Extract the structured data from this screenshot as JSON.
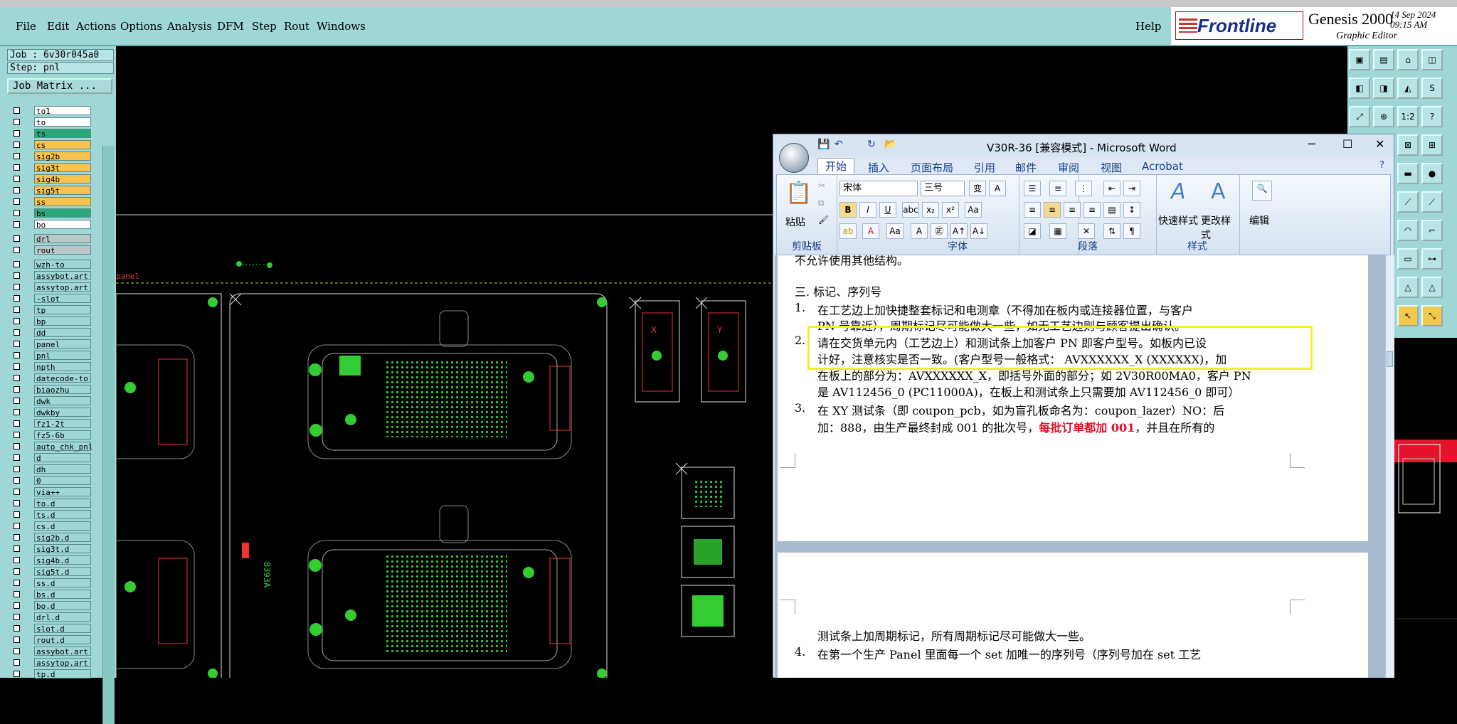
{
  "menubar": {
    "items": [
      "File",
      "Edit",
      "Actions",
      "Options",
      "Analysis",
      "DFM",
      "Step",
      "Rout",
      "Windows"
    ],
    "help": "Help"
  },
  "brand": {
    "logo": "Frontline",
    "product": "Genesis 2000",
    "subtitle": "Graphic Editor",
    "date": "14 Sep 2024",
    "time": "09:15 AM"
  },
  "left": {
    "job": "Job : 6v30r045a0",
    "step": "Step: pnl",
    "job_matrix": "Job Matrix ...",
    "layers_board": [
      {
        "name": "to1",
        "color": "#ffffff"
      },
      {
        "name": "to",
        "color": "#ffffff"
      },
      {
        "name": "ts",
        "color": "#2aa87a"
      },
      {
        "name": "cs",
        "color": "#f7c24e"
      },
      {
        "name": "sig2b",
        "color": "#f7c24e"
      },
      {
        "name": "sig3t",
        "color": "#f7c24e"
      },
      {
        "name": "sig4b",
        "color": "#f7c24e"
      },
      {
        "name": "sig5t",
        "color": "#f7c24e"
      },
      {
        "name": "ss",
        "color": "#f7c24e"
      },
      {
        "name": "bs",
        "color": "#2aa87a"
      },
      {
        "name": "bo",
        "color": "#ffffff"
      }
    ],
    "layers_drill": [
      {
        "name": "drl",
        "color": "#b9c9c9"
      },
      {
        "name": "rout",
        "color": "#b9c9c9"
      }
    ],
    "layers_misc": [
      "wzh-to",
      "assybot.art",
      "assytop.art",
      "-slot",
      "tp",
      "bp",
      "dd",
      "panel",
      "pnl",
      "npth",
      "datecode-to",
      "biaozhu",
      "dwk",
      "dwkby",
      "fz1-2t",
      "fz5-6b",
      "auto_chk_pnl",
      "d",
      "dh",
      "0",
      "via++",
      "to.d",
      "ts.d",
      "cs.d",
      "sig2b.d",
      "sig3t.d",
      "sig4b.d",
      "sig5t.d",
      "ss.d",
      "bs.d",
      "bo.d",
      "drl.d",
      "slot.d",
      "rout.d",
      "assybot.art",
      "assytop.art",
      "tp.d"
    ]
  },
  "canvas": {
    "panel_label": "panel",
    "coupon_text": "8393A",
    "marks": [
      "X",
      "Y"
    ]
  },
  "toolbox": {
    "buttons": [
      "1:2",
      "?",
      "S"
    ]
  },
  "word": {
    "title": "V30R-36 [兼容模式] - Microsoft Word",
    "tabs": [
      "开始",
      "插入",
      "页面布局",
      "引用",
      "邮件",
      "审阅",
      "视图",
      "Acrobat"
    ],
    "font_name": "宋体",
    "font_size": "三号",
    "groups": [
      "剪贴板",
      "字体",
      "段落",
      "样式"
    ],
    "paste": "粘贴",
    "quick_styles": "快速样式",
    "change_styles": "更改样式",
    "edit": "编辑",
    "controls": {
      "min": "─",
      "max": "☐",
      "close": "✕"
    },
    "doc": {
      "line0": "不允许使用其他结构。",
      "heading": "三. 标记、序列号",
      "p1a": "在工艺边上加快捷整套标记和电测章（不得加在板内或连接器位置，与客户",
      "p1b": "PN 号靠近），周期标记尽可能做大一些，如无工艺边则与顾客提出确认。",
      "p2a": "请在交货单元内（工艺边上）和测试条上加客户 PN 即客户型号。如板内已设",
      "p2b": "计好，注意核实是否一致。(客户型号一般格式： AVXXXXXX_X (XXXXXX)，加",
      "p2c": "在板上的部分为：AVXXXXXX_X，即括号外面的部分；如 2V30R00MA0，客户 PN",
      "p2d": "是 AV112456_0 (PC11000A)，在板上和测试条上只需要加 AV112456_0 即可）",
      "p3a": "在 XY 测试条（即 coupon_pcb，如为盲孔板命名为：coupon_lazer）NO：后",
      "p3b_pre": "加：888，由生产最终封成 001 的批次号，",
      "p3b_red": "每批订单都加 001",
      "p3b_post": "，并且在所有的",
      "p3c": "测试条上加周期标记，所有周期标记尽可能做大一些。",
      "p4a": "在第一个生产 Panel 里面每一个 set 加唯一的序列号（序列号加在 set 工艺",
      "nums": [
        "1.",
        "2.",
        "3.",
        "4."
      ]
    }
  }
}
